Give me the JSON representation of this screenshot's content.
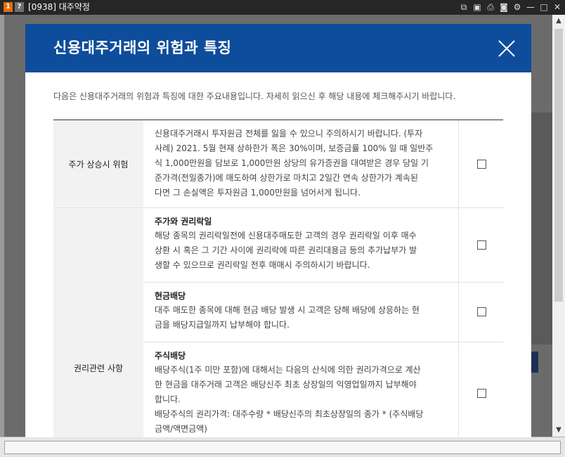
{
  "window": {
    "badge1": "1",
    "badge2": "?",
    "title": "[0938] 대주약정",
    "icons": [
      "link-icon",
      "save-icon",
      "print-icon",
      "camera-icon",
      "gear-icon",
      "minimize-icon",
      "maximize-icon",
      "close-icon"
    ],
    "badge1_color": "#e46c0a",
    "badge2_color": "#6f6f6f"
  },
  "modal": {
    "title": "신용대주거래의 위험과 특징",
    "intro": "다음은 신용대주거래의 위험과 특징에 대한 주요내용입니다. 자세히 읽으신 후 해당 내용에 체크해주시기 바랍니다.",
    "header_color": "#0e4d9b",
    "categories": [
      {
        "label": "주가 상승시 위험"
      },
      {
        "label": "권리관련 사항"
      }
    ],
    "items": [
      {
        "title": "",
        "text": "신용대주거래시 투자원금 전체를 잃을 수 있으니 주의하시기 바랍니다. (투자\n사례) 2021. 5월 현재 상하한가 폭은 30%이며, 보증금률 100% 일 때 일반주\n식 1,000만원을 담보로 1,000만원 상당의 유가증권을 대여받은 경우 당일 기\n준가격(전일종가)에 매도하여 상한가로 마치고 2일간 연속 상한가가 계속된\n다면 그 손실액은 투자원금 1,000만원을 넘어서게 됩니다.",
        "checked": false
      },
      {
        "title": "주가와 권리락일",
        "text": "해당 종목의 권리락일전에 신용대주매도한 고객의 경우 권리락일 이후 매수\n상환 시 혹은 그 기간 사이에 권리락에 따른 권리대용금 등의 추가납부가 발\n생할 수 있으므로 권리락일 전후 매매시 주의하시기 바랍니다.",
        "checked": false
      },
      {
        "title": "현금배당",
        "text": "대주 매도한 종목에 대해 현금 배당 발생 시 고객은 당해 배당에 상응하는 현\n금을 배당지급일까지 납부해야 합니다.",
        "checked": false
      },
      {
        "title": "주식배당",
        "text": "배당주식(1주 미만 포함)에 대해서는 다음의 산식에 의한 권리가격으로 계산\n한 현금을 대주거래 고객은 배당신주 최초 상장일의 익영업일까지 납부해야\n합니다.\n배당주식의 권리가격: 대주수량 * 배당신주의 최초상장일의 종가 * (주식배당\n금액/액면금액)",
        "checked": false
      }
    ]
  },
  "scrollbar": {
    "up": "▲",
    "down": "▼"
  }
}
